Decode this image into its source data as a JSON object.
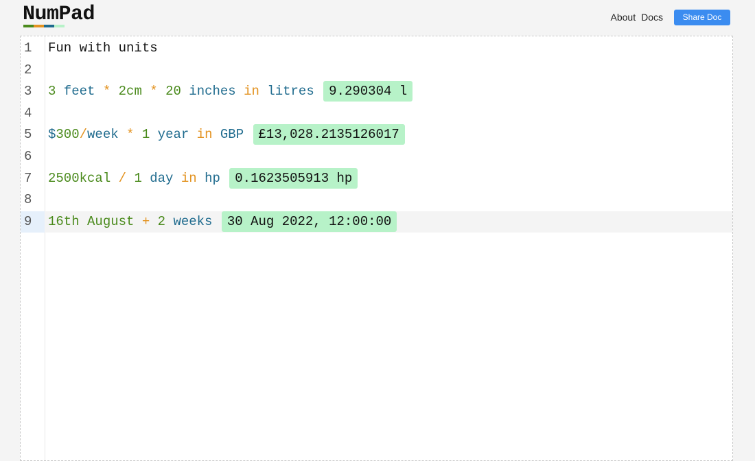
{
  "app": {
    "logo": "NumPad"
  },
  "colors": {
    "logo_bar": [
      "#4a8a1c",
      "#e39321",
      "#1f6b8e",
      "#b7f2c8"
    ],
    "number": "#4a8a1c",
    "unit": "#1f6b8e",
    "operator": "#e39321",
    "result_background": "#b7f2c8",
    "share_button": "#3b8cf0"
  },
  "nav": {
    "about": "About",
    "docs": "Docs",
    "share": "Share Doc"
  },
  "editor": {
    "line_numbers": [
      "1",
      "2",
      "3",
      "4",
      "5",
      "6",
      "7",
      "8",
      "9"
    ],
    "line1": {
      "text": "Fun with units"
    },
    "line3": {
      "t1": "3",
      "t2": " feet",
      "t3": " * ",
      "t4": "2",
      "t5": "cm",
      "t6": " * ",
      "t7": "20",
      "t8": " inches",
      "t9": " in ",
      "t10": "litres",
      "result": "9.290304 l"
    },
    "line5": {
      "t1": "$",
      "t2": "300",
      "t3": "/",
      "t4": "week",
      "t5": " * ",
      "t6": "1",
      "t7": " year",
      "t8": " in ",
      "t9": "GBP",
      "result": "£13,028.2135126017"
    },
    "line7": {
      "t1": "2500",
      "t2": "kcal",
      "t3": " / ",
      "t4": "1",
      "t5": " day",
      "t6": " in ",
      "t7": "hp",
      "result": "0.1623505913 hp"
    },
    "line9": {
      "t1": "16th August",
      "t2": " + ",
      "t3": "2",
      "t4": " weeks",
      "result": "30 Aug 2022, 12:00:00"
    }
  }
}
